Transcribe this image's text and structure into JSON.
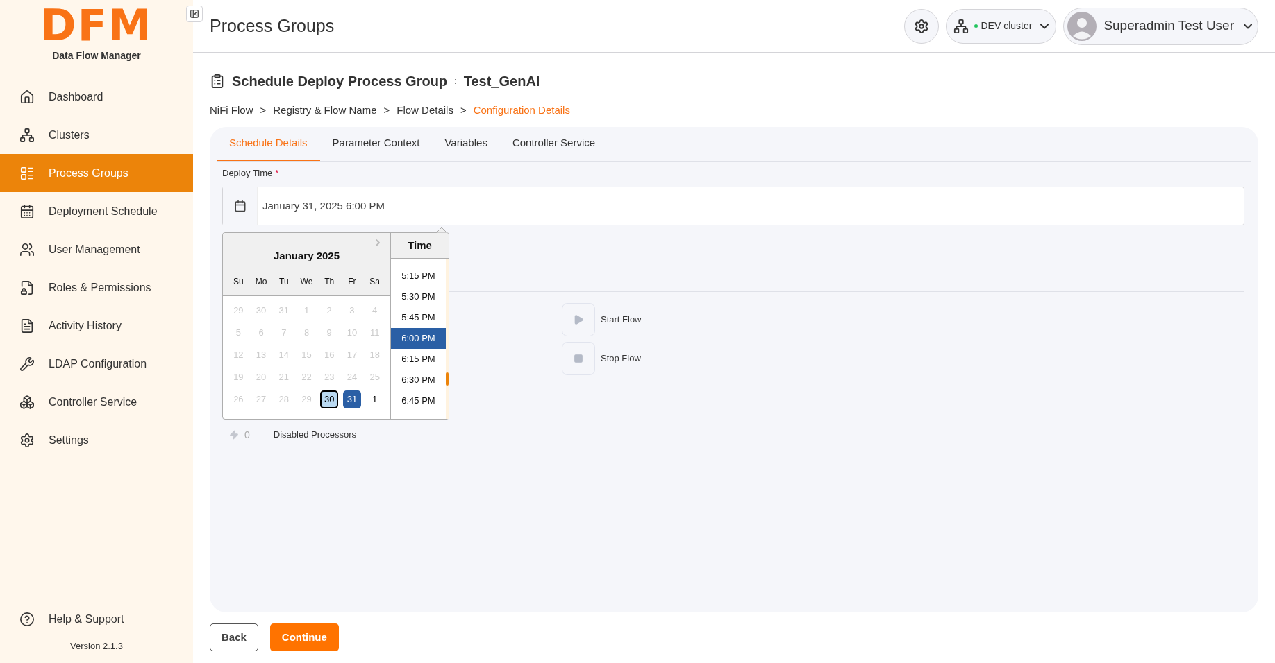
{
  "logo": {
    "mark": "DFM",
    "subtitle": "Data Flow Manager"
  },
  "sidebar": {
    "items": [
      {
        "label": "Dashboard",
        "selected": false
      },
      {
        "label": "Clusters",
        "selected": false
      },
      {
        "label": "Process Groups",
        "selected": true
      },
      {
        "label": "Deployment Schedule",
        "selected": false
      },
      {
        "label": "User Management",
        "selected": false
      },
      {
        "label": "Roles & Permissions",
        "selected": false
      },
      {
        "label": "Activity History",
        "selected": false
      },
      {
        "label": "LDAP Configuration",
        "selected": false
      },
      {
        "label": "Controller Service",
        "selected": false
      },
      {
        "label": "Settings",
        "selected": false
      }
    ],
    "footer_item": {
      "label": "Help & Support"
    },
    "version": "Version 2.1.3"
  },
  "header": {
    "title": "Process Groups",
    "cluster": {
      "label": "DEV cluster"
    },
    "user": {
      "name": "Superadmin Test User"
    }
  },
  "page": {
    "title": "Schedule Deploy Process Group",
    "separator": ":",
    "name": "Test_GenAI"
  },
  "breadcrumb": [
    {
      "label": "NiFi Flow",
      "selected": false
    },
    {
      "label": "Registry & Flow Name",
      "selected": false
    },
    {
      "label": "Flow Details",
      "selected": false
    },
    {
      "label": "Configuration Details",
      "selected": true
    }
  ],
  "breadcrumb_separator": ">",
  "tabs": [
    {
      "label": "Schedule Details",
      "selected": true
    },
    {
      "label": "Parameter Context",
      "selected": false
    },
    {
      "label": "Variables",
      "selected": false
    },
    {
      "label": "Controller Service",
      "selected": false
    }
  ],
  "deploy_time": {
    "label": "Deploy Time",
    "required_mark": "*",
    "value": "January 31, 2025 6:00 PM"
  },
  "datepicker": {
    "month": "January 2025",
    "weekdays": [
      "Su",
      "Mo",
      "Tu",
      "We",
      "Th",
      "Fr",
      "Sa"
    ],
    "weeks": [
      [
        {
          "day": "29",
          "disabled": true,
          "selected": false,
          "focused": false
        },
        {
          "day": "30",
          "disabled": true,
          "selected": false,
          "focused": false
        },
        {
          "day": "31",
          "disabled": true,
          "selected": false,
          "focused": false
        },
        {
          "day": "1",
          "disabled": true,
          "selected": false,
          "focused": false
        },
        {
          "day": "2",
          "disabled": true,
          "selected": false,
          "focused": false
        },
        {
          "day": "3",
          "disabled": true,
          "selected": false,
          "focused": false
        },
        {
          "day": "4",
          "disabled": true,
          "selected": false,
          "focused": false
        }
      ],
      [
        {
          "day": "5",
          "disabled": true,
          "selected": false,
          "focused": false
        },
        {
          "day": "6",
          "disabled": true,
          "selected": false,
          "focused": false
        },
        {
          "day": "7",
          "disabled": true,
          "selected": false,
          "focused": false
        },
        {
          "day": "8",
          "disabled": true,
          "selected": false,
          "focused": false
        },
        {
          "day": "9",
          "disabled": true,
          "selected": false,
          "focused": false
        },
        {
          "day": "10",
          "disabled": true,
          "selected": false,
          "focused": false
        },
        {
          "day": "11",
          "disabled": true,
          "selected": false,
          "focused": false
        }
      ],
      [
        {
          "day": "12",
          "disabled": true,
          "selected": false,
          "focused": false
        },
        {
          "day": "13",
          "disabled": true,
          "selected": false,
          "focused": false
        },
        {
          "day": "14",
          "disabled": true,
          "selected": false,
          "focused": false
        },
        {
          "day": "15",
          "disabled": true,
          "selected": false,
          "focused": false
        },
        {
          "day": "16",
          "disabled": true,
          "selected": false,
          "focused": false
        },
        {
          "day": "17",
          "disabled": true,
          "selected": false,
          "focused": false
        },
        {
          "day": "18",
          "disabled": true,
          "selected": false,
          "focused": false
        }
      ],
      [
        {
          "day": "19",
          "disabled": true,
          "selected": false,
          "focused": false
        },
        {
          "day": "20",
          "disabled": true,
          "selected": false,
          "focused": false
        },
        {
          "day": "21",
          "disabled": true,
          "selected": false,
          "focused": false
        },
        {
          "day": "22",
          "disabled": true,
          "selected": false,
          "focused": false
        },
        {
          "day": "23",
          "disabled": true,
          "selected": false,
          "focused": false
        },
        {
          "day": "24",
          "disabled": true,
          "selected": false,
          "focused": false
        },
        {
          "day": "25",
          "disabled": true,
          "selected": false,
          "focused": false
        }
      ],
      [
        {
          "day": "26",
          "disabled": true,
          "selected": false,
          "focused": false
        },
        {
          "day": "27",
          "disabled": true,
          "selected": false,
          "focused": false
        },
        {
          "day": "28",
          "disabled": true,
          "selected": false,
          "focused": false
        },
        {
          "day": "29",
          "disabled": true,
          "selected": false,
          "focused": false
        },
        {
          "day": "30",
          "disabled": false,
          "selected": false,
          "focused": true
        },
        {
          "day": "31",
          "disabled": false,
          "selected": true,
          "focused": false
        },
        {
          "day": "1",
          "disabled": false,
          "selected": false,
          "focused": false
        }
      ]
    ],
    "time_header": "Time",
    "times": [
      {
        "label": "5:15 PM",
        "selected": false
      },
      {
        "label": "5:30 PM",
        "selected": false
      },
      {
        "label": "5:45 PM",
        "selected": false
      },
      {
        "label": "6:00 PM",
        "selected": true
      },
      {
        "label": "6:15 PM",
        "selected": false
      },
      {
        "label": "6:30 PM",
        "selected": false
      },
      {
        "label": "6:45 PM",
        "selected": false
      }
    ]
  },
  "flow_actions": [
    {
      "label": "Start Flow",
      "kind": "start"
    },
    {
      "label": "Stop Flow",
      "kind": "stop"
    }
  ],
  "disabled_processors": {
    "count": "0",
    "label": "Disabled Processors"
  },
  "buttons": [
    {
      "label": "Back",
      "kind": "secondary"
    },
    {
      "label": "Continue",
      "kind": "primary"
    }
  ]
}
